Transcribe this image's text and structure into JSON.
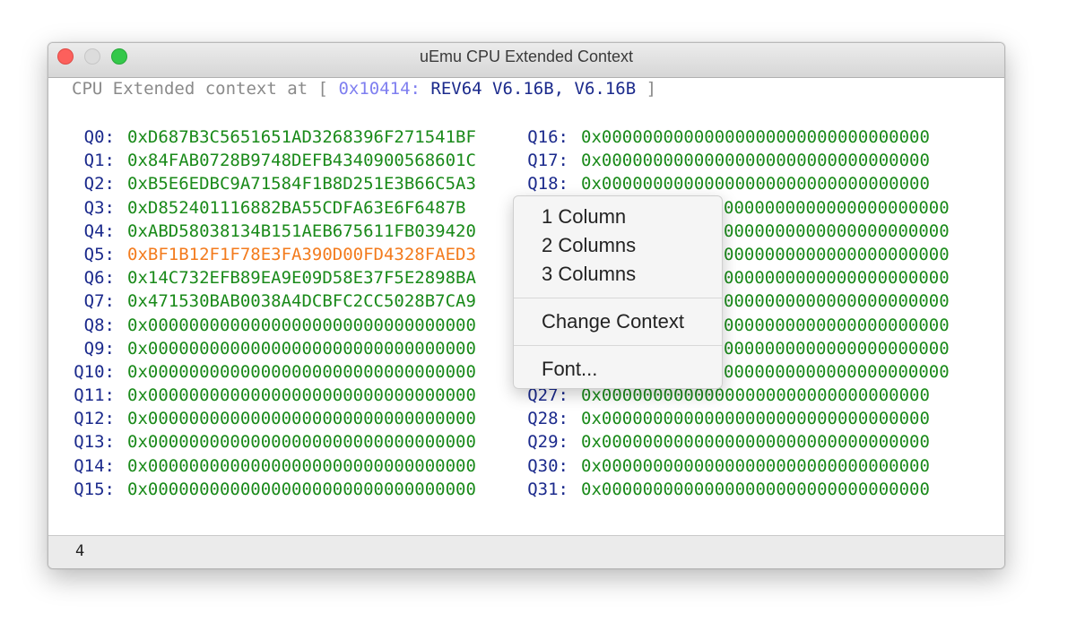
{
  "window": {
    "title": "uEmu CPU Extended Context"
  },
  "header": {
    "prefix": "CPU Extended context at [",
    "address": "0x10414:",
    "instruction": "REV64 V6.16B, V6.16B",
    "suffix": "]"
  },
  "registers": {
    "left": [
      {
        "name": "Q0:",
        "value": "0xD687B3C5651651AD3268396F271541BF",
        "changed": false
      },
      {
        "name": "Q1:",
        "value": "0x84FAB0728B9748DEFB4340900568601C",
        "changed": false
      },
      {
        "name": "Q2:",
        "value": "0xB5E6EDBC9A71584F1B8D251E3B66C5A3",
        "changed": false
      },
      {
        "name": "Q3:",
        "value": "0xD852401116882BA55CDFA63E6F6487B",
        "changed": false
      },
      {
        "name": "Q4:",
        "value": "0xABD58038134B151AEB675611FB039420",
        "changed": false
      },
      {
        "name": "Q5:",
        "value": "0xBF1B12F1F78E3FA390D00FD4328FAED3",
        "changed": true
      },
      {
        "name": "Q6:",
        "value": "0x14C732EFB89EA9E09D58E37F5E2898BA",
        "changed": false
      },
      {
        "name": "Q7:",
        "value": "0x471530BAB0038A4DCBFC2CC5028B7CA9",
        "changed": false
      },
      {
        "name": "Q8:",
        "value": "0x00000000000000000000000000000000",
        "changed": false
      },
      {
        "name": "Q9:",
        "value": "0x00000000000000000000000000000000",
        "changed": false
      },
      {
        "name": "Q10:",
        "value": "0x00000000000000000000000000000000",
        "changed": false
      },
      {
        "name": "Q11:",
        "value": "0x00000000000000000000000000000000",
        "changed": false
      },
      {
        "name": "Q12:",
        "value": "0x00000000000000000000000000000000",
        "changed": false
      },
      {
        "name": "Q13:",
        "value": "0x00000000000000000000000000000000",
        "changed": false
      },
      {
        "name": "Q14:",
        "value": "0x00000000000000000000000000000000",
        "changed": false
      },
      {
        "name": "Q15:",
        "value": "0x00000000000000000000000000000000",
        "changed": false
      }
    ],
    "right": [
      {
        "name": "Q16:",
        "value": "0x00000000000000000000000000000000",
        "changed": false
      },
      {
        "name": "Q17:",
        "value": "0x00000000000000000000000000000000",
        "changed": false
      },
      {
        "name": "Q18:",
        "value": "0x00000000000000000000000000000000",
        "changed": false
      },
      {
        "name": "",
        "value": "0000000000000000000000",
        "changed": false
      },
      {
        "name": "",
        "value": "0000000000000000000000",
        "changed": false
      },
      {
        "name": "",
        "value": "0000000000000000000000",
        "changed": false
      },
      {
        "name": "",
        "value": "0000000000000000000000",
        "changed": false
      },
      {
        "name": "",
        "value": "0000000000000000000000",
        "changed": false
      },
      {
        "name": "",
        "value": "0000000000000000000000",
        "changed": false
      },
      {
        "name": "",
        "value": "0000000000000000000000",
        "changed": false
      },
      {
        "name": "",
        "value": "0000000000000000000000",
        "changed": false
      },
      {
        "name": "Q27:",
        "value": "0x00000000000000000000000000000000",
        "changed": false
      },
      {
        "name": "Q28:",
        "value": "0x00000000000000000000000000000000",
        "changed": false
      },
      {
        "name": "Q29:",
        "value": "0x00000000000000000000000000000000",
        "changed": false
      },
      {
        "name": "Q30:",
        "value": "0x00000000000000000000000000000000",
        "changed": false
      },
      {
        "name": "Q31:",
        "value": "0x00000000000000000000000000000000",
        "changed": false
      }
    ]
  },
  "status": {
    "text": "4"
  },
  "context_menu": {
    "items": [
      "1 Column",
      "2 Columns",
      "3 Columns",
      "Change Context",
      "Font..."
    ]
  },
  "colors": {
    "register_name": "#1b2a8c",
    "register_value": "#1a8a1a",
    "register_changed": "#f37b1d",
    "address": "#7f7ff0"
  }
}
